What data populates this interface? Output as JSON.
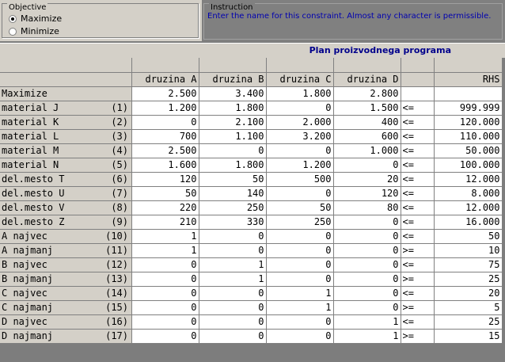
{
  "objective": {
    "legend": "Objective",
    "options": [
      "Maximize",
      "Minimize"
    ],
    "selected": 0
  },
  "instruction": {
    "legend": "Instruction",
    "text": "Enter the name for this constraint. Almost any character is permissible."
  },
  "grid_title": "Plan proizvodnega programa",
  "columns": [
    "druzina A",
    "druzina B",
    "druzina C",
    "druzina D"
  ],
  "rhs_label": "RHS",
  "objective_row": {
    "label": "Maximize",
    "values": [
      "2.500",
      "3.400",
      "1.800",
      "2.800"
    ]
  },
  "constraints": [
    {
      "name": "material J",
      "idx": "(1)",
      "values": [
        "1.200",
        "1.800",
        "0",
        "1.500"
      ],
      "op": "<=",
      "rhs": "999.999"
    },
    {
      "name": "material K",
      "idx": "(2)",
      "values": [
        "0",
        "2.100",
        "2.000",
        "400"
      ],
      "op": "<=",
      "rhs": "120.000"
    },
    {
      "name": "material L",
      "idx": "(3)",
      "values": [
        "700",
        "1.100",
        "3.200",
        "600"
      ],
      "op": "<=",
      "rhs": "110.000"
    },
    {
      "name": "material M",
      "idx": "(4)",
      "values": [
        "2.500",
        "0",
        "0",
        "1.000"
      ],
      "op": "<=",
      "rhs": "50.000"
    },
    {
      "name": "material N",
      "idx": "(5)",
      "values": [
        "1.600",
        "1.800",
        "1.200",
        "0"
      ],
      "op": "<=",
      "rhs": "100.000"
    },
    {
      "name": "del.mesto T",
      "idx": "(6)",
      "values": [
        "120",
        "50",
        "500",
        "20"
      ],
      "op": "<=",
      "rhs": "12.000"
    },
    {
      "name": "del.mesto U",
      "idx": "(7)",
      "values": [
        "50",
        "140",
        "0",
        "120"
      ],
      "op": "<=",
      "rhs": "8.000"
    },
    {
      "name": "del.mesto V",
      "idx": "(8)",
      "values": [
        "220",
        "250",
        "50",
        "80"
      ],
      "op": "<=",
      "rhs": "12.000"
    },
    {
      "name": "del.mesto Z",
      "idx": "(9)",
      "values": [
        "210",
        "330",
        "250",
        "0"
      ],
      "op": "<=",
      "rhs": "16.000"
    },
    {
      "name": "A najvec",
      "idx": "(10)",
      "values": [
        "1",
        "0",
        "0",
        "0"
      ],
      "op": "<=",
      "rhs": "50"
    },
    {
      "name": "A najmanj",
      "idx": "(11)",
      "values": [
        "1",
        "0",
        "0",
        "0"
      ],
      "op": ">=",
      "rhs": "10"
    },
    {
      "name": "B najvec",
      "idx": "(12)",
      "values": [
        "0",
        "1",
        "0",
        "0"
      ],
      "op": "<=",
      "rhs": "75"
    },
    {
      "name": "B najmanj",
      "idx": "(13)",
      "values": [
        "0",
        "1",
        "0",
        "0"
      ],
      "op": ">=",
      "rhs": "25"
    },
    {
      "name": "C najvec",
      "idx": "(14)",
      "values": [
        "0",
        "0",
        "1",
        "0"
      ],
      "op": "<=",
      "rhs": "20"
    },
    {
      "name": "C najmanj",
      "idx": "(15)",
      "values": [
        "0",
        "0",
        "1",
        "0"
      ],
      "op": ">=",
      "rhs": "5"
    },
    {
      "name": "D najvec",
      "idx": "(16)",
      "values": [
        "0",
        "0",
        "0",
        "1"
      ],
      "op": "<=",
      "rhs": "25"
    },
    {
      "name": "D najmanj",
      "idx": "(17)",
      "values": [
        "0",
        "0",
        "0",
        "1"
      ],
      "op": ">=",
      "rhs": "15"
    }
  ]
}
